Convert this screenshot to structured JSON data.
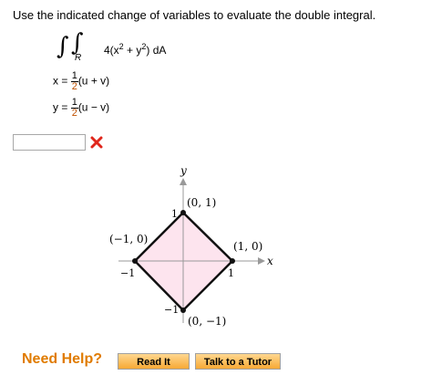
{
  "prompt": "Use the indicated change of variables to evaluate the double integral.",
  "integral": {
    "region": "R",
    "integrand": "4(x",
    "integrand_mid": " + y",
    "integrand_end": ") dA",
    "sup": "2"
  },
  "transform": {
    "x_lhs": "x =",
    "y_lhs": "y =",
    "numerator": "1",
    "denominator": "2",
    "x_rhs": "(u + v)",
    "y_rhs": "(u − v)"
  },
  "answer": {
    "value": "",
    "status_icon": "cross-icon",
    "status_color": "#e0261b"
  },
  "figure": {
    "axis_x_label": "x",
    "axis_y_label": "y",
    "tick_pos_y": "1",
    "tick_neg_y": "−1",
    "tick_pos_x": "1",
    "tick_neg_x": "−1",
    "pt_top": "(0, 1)",
    "pt_left": "(−1, 0)",
    "pt_right": "(1, 0)",
    "pt_bottom": "(0, −1)",
    "fill_color": "#fde4ee"
  },
  "help": {
    "label": "Need Help?",
    "read_it": "Read It",
    "talk_to_tutor": "Talk to a Tutor"
  }
}
